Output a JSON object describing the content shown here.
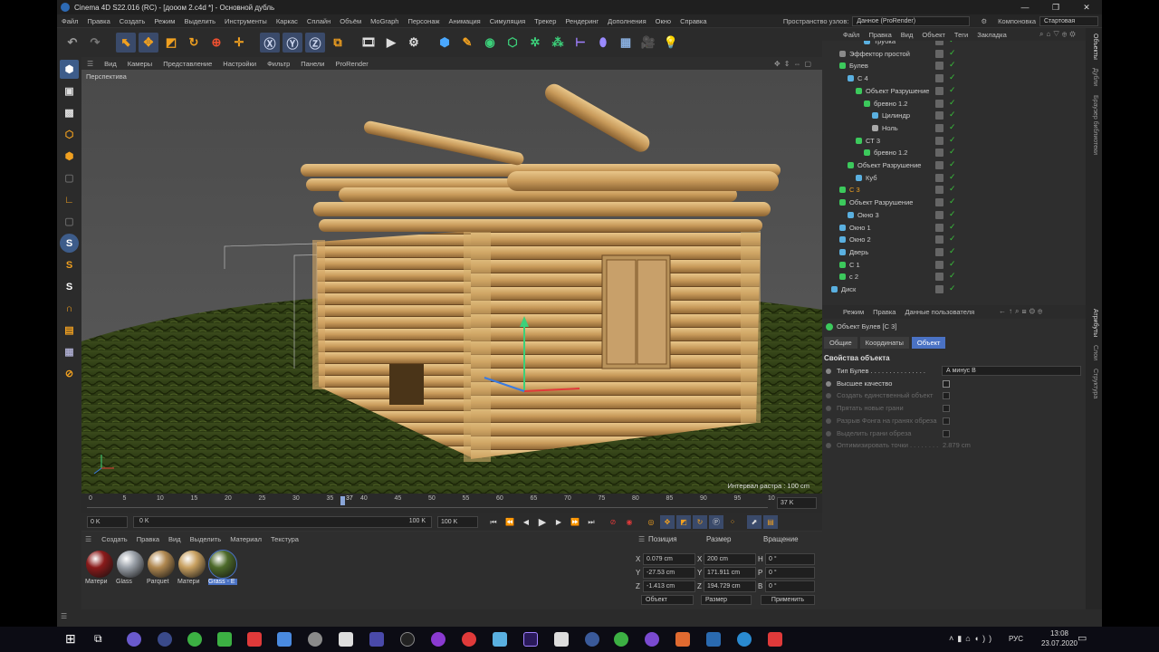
{
  "window": {
    "title": "Cinema 4D S22.016 (RC) - [дооом 2.c4d *] - Основной дубль",
    "controls": [
      "—",
      "❐",
      "✕"
    ]
  },
  "menubar": [
    "Файл",
    "Правка",
    "Создать",
    "Режим",
    "Выделить",
    "Инструменты",
    "Каркас",
    "Сплайн",
    "Объём",
    "MoGraph",
    "Персонаж",
    "Анимация",
    "Симуляция",
    "Трекер",
    "Рендеринг",
    "Дополнения",
    "Окно",
    "Справка"
  ],
  "node_space": {
    "label": "Пространство узлов:",
    "value": "Данное (ProRender)"
  },
  "layout": {
    "label": "Компоновка",
    "value": "Стартовая"
  },
  "viewport": {
    "menu": [
      "Вид",
      "Камеры",
      "Представление",
      "Настройки",
      "Фильтр",
      "Панели",
      "ProRender"
    ],
    "label": "Перспектива",
    "grid_interval": "Интервал растра : 100 cm"
  },
  "timeline": {
    "ticks": [
      "0",
      "5",
      "10",
      "15",
      "20",
      "25",
      "30",
      "35",
      "40",
      "45",
      "50",
      "55",
      "60",
      "65",
      "70",
      "75",
      "80",
      "85",
      "90",
      "95",
      "10"
    ],
    "current_frame": "37",
    "end_field": "37 K",
    "start": "0 K",
    "range_start": "0 K",
    "range_end": "100 K",
    "end": "100 K"
  },
  "materials": {
    "menu": [
      "Создать",
      "Правка",
      "Вид",
      "Выделить",
      "Материал",
      "Текстура"
    ],
    "items": [
      {
        "label": "Матери",
        "color": "#8a1a1a"
      },
      {
        "label": "Glass",
        "color": "#9aa0a8"
      },
      {
        "label": "Parquet",
        "color": "#b08850"
      },
      {
        "label": "Матери",
        "color": "#c8a060"
      },
      {
        "label": "Grass - E",
        "color": "#4d6a2a"
      }
    ]
  },
  "coords": {
    "headers": [
      "Позиция",
      "Размер",
      "Вращение"
    ],
    "rows": [
      {
        "axis": "X",
        "pos": "0.079 cm",
        "size": "200 cm",
        "rot_axis": "H",
        "rot": "0 °"
      },
      {
        "axis": "Y",
        "pos": "-27.53 cm",
        "size": "171.911 cm",
        "rot_axis": "P",
        "rot": "0 °"
      },
      {
        "axis": "Z",
        "pos": "-1.413 cm",
        "size": "194.729 cm",
        "rot_axis": "B",
        "rot": "0 °"
      }
    ],
    "mode": "Объект",
    "size_mode": "Размер",
    "apply": "Применить"
  },
  "objects": {
    "menu": [
      "Файл",
      "Правка",
      "Вид",
      "Объект",
      "Теги",
      "Закладка"
    ],
    "rows": [
      {
        "name": "Трубка",
        "indent": 4,
        "color": "#5ab0e0"
      },
      {
        "name": "Эффектор простой",
        "indent": 1,
        "color": "#8a8a8a"
      },
      {
        "name": "Булев",
        "indent": 1,
        "color": "#3cc95c"
      },
      {
        "name": "С 4",
        "indent": 2,
        "color": "#5ab0e0"
      },
      {
        "name": "Объект Разрушение",
        "indent": 3,
        "color": "#3cc95c"
      },
      {
        "name": "бревно 1.2",
        "indent": 4,
        "color": "#3cc95c"
      },
      {
        "name": "Цилиндр",
        "indent": 5,
        "color": "#5ab0e0"
      },
      {
        "name": "Ноль",
        "indent": 5,
        "color": "#aaaaaa"
      },
      {
        "name": "СТ 3",
        "indent": 3,
        "color": "#3cc95c"
      },
      {
        "name": "бревно 1.2",
        "indent": 4,
        "color": "#3cc95c"
      },
      {
        "name": "Объект Разрушение",
        "indent": 2,
        "color": "#3cc95c"
      },
      {
        "name": "Куб",
        "indent": 3,
        "color": "#5ab0e0"
      },
      {
        "name": "С 3",
        "indent": 1,
        "color": "#3cc95c",
        "highlight": true
      },
      {
        "name": "Объект Разрушение",
        "indent": 1,
        "color": "#3cc95c"
      },
      {
        "name": "Окно 3",
        "indent": 2,
        "color": "#5ab0e0"
      },
      {
        "name": "Окно 1",
        "indent": 1,
        "color": "#5ab0e0"
      },
      {
        "name": "Окно 2",
        "indent": 1,
        "color": "#5ab0e0"
      },
      {
        "name": "Дверь",
        "indent": 1,
        "color": "#5ab0e0"
      },
      {
        "name": "С 1",
        "indent": 1,
        "color": "#3cc95c"
      },
      {
        "name": "с 2",
        "indent": 1,
        "color": "#3cc95c"
      },
      {
        "name": "Диск",
        "indent": 0,
        "color": "#5ab0e0"
      }
    ]
  },
  "side_tabs_top": [
    "Объекты",
    "Дубли",
    "Браузер библиотеки"
  ],
  "side_tabs_bottom": [
    "Атрибуты",
    "Слои",
    "Структура"
  ],
  "attributes": {
    "menu": [
      "Режим",
      "Правка",
      "Данные пользователя"
    ],
    "object_title": "Объект Булев [С 3]",
    "tabs": [
      "Общие",
      "Координаты",
      "Объект"
    ],
    "active_tab": "Объект",
    "section": "Свойства объекта",
    "props": [
      {
        "label": "Тип Булев . . . . . . . . . . . . . . .",
        "value": "А минус В",
        "enabled": true
      },
      {
        "label": "Высшее качество",
        "value": "",
        "enabled": true
      },
      {
        "label": "Создать единственный объект",
        "value": "",
        "enabled": false
      },
      {
        "label": "Прятать новые грани",
        "value": "",
        "enabled": false
      },
      {
        "label": "Разрыв Фонга на гранях обреза",
        "value": "",
        "enabled": false
      },
      {
        "label": "Выделить грани обреза",
        "value": "",
        "enabled": false
      },
      {
        "label": "Оптимизировать точки . . . . . . . .",
        "value": "2.879 cm",
        "enabled": false
      }
    ]
  },
  "taskbar": {
    "lang": "РУС",
    "time": "13:08",
    "date": "23.07.2020"
  }
}
